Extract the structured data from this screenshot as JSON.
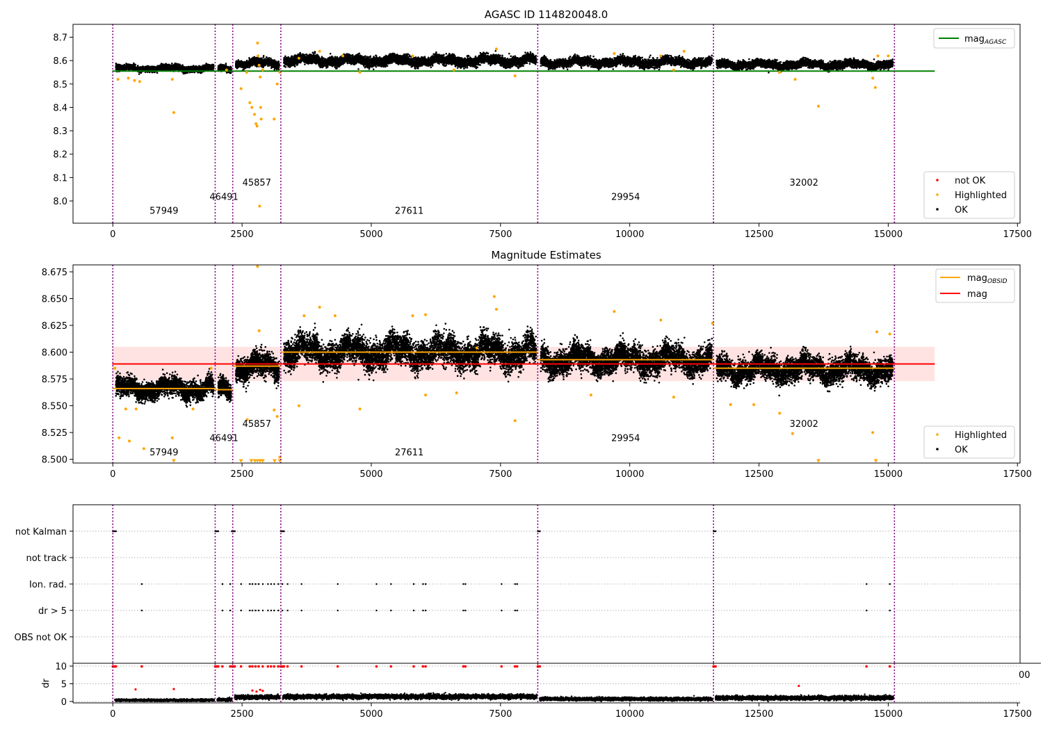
{
  "colors": {
    "ok": "#000000",
    "highlighted": "#ffa500",
    "not_ok": "#ff0000",
    "agasc_line": "#008000",
    "mag_line": "#ff0000",
    "obsid_line": "#ffa500",
    "band": "#ffc0c0",
    "obsid_vline": "#800080"
  },
  "chart_data": [
    {
      "type": "scatter",
      "title": "AGASC ID 114820048.0",
      "xlim": [
        -770,
        17550
      ],
      "ylim": [
        7.905,
        8.755
      ],
      "xticks": [
        0,
        2500,
        5000,
        7500,
        10000,
        12500,
        15000,
        17500
      ],
      "yticks": [
        8.0,
        8.1,
        8.2,
        8.3,
        8.4,
        8.5,
        8.6,
        8.7
      ],
      "ytick_labels": [
        "8.0",
        "8.1",
        "8.2",
        "8.3",
        "8.4",
        "8.5",
        "8.6",
        "8.7"
      ],
      "obsid_boundaries": [
        0,
        1980,
        2320,
        3250,
        8220,
        11620,
        15120
      ],
      "obsid_labels": [
        {
          "text": "57949",
          "x": 990,
          "y": 7.945
        },
        {
          "text": "46491",
          "x": 2150,
          "y": 8.005
        },
        {
          "text": "45857",
          "x": 2785,
          "y": 8.065
        },
        {
          "text": "27611",
          "x": 5735,
          "y": 7.945
        },
        {
          "text": "29954",
          "x": 9920,
          "y": 8.005
        },
        {
          "text": "32002",
          "x": 13370,
          "y": 8.065
        }
      ],
      "segments": [
        {
          "x0": 0,
          "x1": 1980,
          "base": 8.567,
          "spread": 0.015
        },
        {
          "x0": 1980,
          "x1": 2320,
          "base": 8.565,
          "spread": 0.015
        },
        {
          "x0": 2320,
          "x1": 3250,
          "base": 8.588,
          "spread": 0.02
        },
        {
          "x0": 3250,
          "x1": 8220,
          "base": 8.6,
          "spread": 0.024
        },
        {
          "x0": 8220,
          "x1": 11620,
          "base": 8.593,
          "spread": 0.022
        },
        {
          "x0": 11620,
          "x1": 15120,
          "base": 8.583,
          "spread": 0.02
        }
      ],
      "hlines": [
        {
          "name": "mag_AGASC",
          "y": 8.555,
          "x0": -10,
          "x1": 15900,
          "color": "#008000"
        }
      ],
      "highlighted": [
        [
          100,
          8.52
        ],
        [
          300,
          8.525
        ],
        [
          420,
          8.515
        ],
        [
          520,
          8.51
        ],
        [
          1150,
          8.52
        ],
        [
          1180,
          8.378
        ],
        [
          2200,
          8.56
        ],
        [
          2480,
          8.48
        ],
        [
          2590,
          8.55
        ],
        [
          2650,
          8.42
        ],
        [
          2690,
          8.4
        ],
        [
          2740,
          8.37
        ],
        [
          2770,
          8.33
        ],
        [
          2790,
          8.32
        ],
        [
          2800,
          8.675
        ],
        [
          2810,
          8.62
        ],
        [
          2830,
          8.58
        ],
        [
          2850,
          8.53
        ],
        [
          2860,
          8.4
        ],
        [
          2870,
          8.35
        ],
        [
          2900,
          8.56
        ],
        [
          3120,
          8.35
        ],
        [
          3180,
          8.5
        ],
        [
          3230,
          8.55
        ],
        [
          3600,
          8.61
        ],
        [
          4000,
          8.64
        ],
        [
          4450,
          8.62
        ],
        [
          4780,
          8.55
        ],
        [
          5800,
          8.62
        ],
        [
          7420,
          8.65
        ],
        [
          7780,
          8.535
        ],
        [
          6600,
          8.56
        ],
        [
          9700,
          8.63
        ],
        [
          10600,
          8.62
        ],
        [
          11050,
          8.64
        ],
        [
          10850,
          8.56
        ],
        [
          12900,
          8.55
        ],
        [
          13200,
          8.52
        ],
        [
          13650,
          8.405
        ],
        [
          14700,
          8.525
        ],
        [
          14750,
          8.485
        ],
        [
          14800,
          8.62
        ],
        [
          15000,
          8.62
        ],
        [
          2840,
          7.978
        ]
      ],
      "legend": [
        {
          "label": "mag",
          "sub": "AGASC",
          "kind": "line",
          "color": "#008000"
        }
      ],
      "legend2": [
        {
          "label": "not OK",
          "kind": "dot",
          "color": "#ff0000"
        },
        {
          "label": "Highlighted",
          "kind": "dot",
          "color": "#ffa500"
        },
        {
          "label": "OK",
          "kind": "dot",
          "color": "#000000"
        }
      ]
    },
    {
      "type": "scatter",
      "title": "Magnitude Estimates",
      "xlim": [
        -770,
        17550
      ],
      "ylim": [
        8.4965,
        8.6815
      ],
      "xticks": [
        0,
        2500,
        5000,
        7500,
        10000,
        12500,
        15000,
        17500
      ],
      "yticks": [
        8.5,
        8.525,
        8.55,
        8.575,
        8.6,
        8.625,
        8.65,
        8.675
      ],
      "ytick_labels": [
        "8.500",
        "8.525",
        "8.550",
        "8.575",
        "8.600",
        "8.625",
        "8.650",
        "8.675"
      ],
      "obsid_boundaries": [
        0,
        1980,
        2320,
        3250,
        8220,
        11620,
        15120
      ],
      "obsid_labels": [
        {
          "text": "57949",
          "x": 990,
          "y": 8.5037
        },
        {
          "text": "46491",
          "x": 2150,
          "y": 8.5169
        },
        {
          "text": "45857",
          "x": 2785,
          "y": 8.5301
        },
        {
          "text": "27611",
          "x": 5735,
          "y": 8.5037
        },
        {
          "text": "29954",
          "x": 9920,
          "y": 8.5169
        },
        {
          "text": "32002",
          "x": 13370,
          "y": 8.5301
        }
      ],
      "segments": [
        {
          "x0": 0,
          "x1": 1980,
          "base": 8.566,
          "spread": 0.011
        },
        {
          "x0": 1980,
          "x1": 2320,
          "base": 8.565,
          "spread": 0.011
        },
        {
          "x0": 2320,
          "x1": 3250,
          "base": 8.586,
          "spread": 0.014
        },
        {
          "x0": 3250,
          "x1": 8220,
          "base": 8.6,
          "spread": 0.017
        },
        {
          "x0": 8220,
          "x1": 11620,
          "base": 8.593,
          "spread": 0.015
        },
        {
          "x0": 11620,
          "x1": 15120,
          "base": 8.584,
          "spread": 0.014
        }
      ],
      "band": {
        "y0": 8.573,
        "y1": 8.605,
        "x0": -10,
        "x1": 15900
      },
      "hlines": [
        {
          "name": "mag",
          "y": 8.589,
          "x0": -10,
          "x1": 15900,
          "color": "#ff0000"
        }
      ],
      "obsid_means": [
        {
          "x0": 0,
          "x1": 1980,
          "y": 8.566
        },
        {
          "x0": 1980,
          "x1": 2320,
          "y": 8.565
        },
        {
          "x0": 2320,
          "x1": 3250,
          "y": 8.587
        },
        {
          "x0": 3250,
          "x1": 8220,
          "y": 8.6
        },
        {
          "x0": 8220,
          "x1": 11620,
          "y": 8.593
        },
        {
          "x0": 11620,
          "x1": 15120,
          "y": 8.585
        }
      ],
      "highlighted": [
        [
          40,
          8.585
        ],
        [
          120,
          8.52
        ],
        [
          250,
          8.547
        ],
        [
          450,
          8.547
        ],
        [
          600,
          8.51
        ],
        [
          320,
          8.517
        ],
        [
          1150,
          8.52
        ],
        [
          1550,
          8.547
        ],
        [
          1900,
          8.585
        ],
        [
          2600,
          8.537
        ],
        [
          2800,
          8.68
        ],
        [
          2830,
          8.62
        ],
        [
          3120,
          8.546
        ],
        [
          3180,
          8.54
        ],
        [
          3230,
          8.502
        ],
        [
          3600,
          8.55
        ],
        [
          3700,
          8.634
        ],
        [
          4000,
          8.642
        ],
        [
          4780,
          8.547
        ],
        [
          4300,
          8.634
        ],
        [
          5400,
          8.6
        ],
        [
          5800,
          8.634
        ],
        [
          6650,
          8.562
        ],
        [
          6050,
          8.635
        ],
        [
          7380,
          8.652
        ],
        [
          7420,
          8.64
        ],
        [
          7780,
          8.536
        ],
        [
          7040,
          8.604
        ],
        [
          9700,
          8.638
        ],
        [
          9250,
          8.56
        ],
        [
          10600,
          8.63
        ],
        [
          10850,
          8.558
        ],
        [
          11600,
          8.627
        ],
        [
          11950,
          8.551
        ],
        [
          12400,
          8.551
        ],
        [
          13150,
          8.524
        ],
        [
          12900,
          8.543
        ],
        [
          14700,
          8.525
        ],
        [
          14780,
          8.619
        ],
        [
          15030,
          8.617
        ],
        [
          6050,
          8.56
        ]
      ],
      "triangles": [
        [
          1180,
          8.4975
        ],
        [
          2480,
          8.4975
        ],
        [
          2680,
          8.4975
        ],
        [
          2750,
          8.4975
        ],
        [
          2800,
          8.4975
        ],
        [
          2850,
          8.4975
        ],
        [
          2900,
          8.4975
        ],
        [
          3130,
          8.4975
        ],
        [
          3230,
          8.4975
        ],
        [
          13650,
          8.4975
        ],
        [
          14760,
          8.4975
        ]
      ],
      "legend": [
        {
          "label": "mag",
          "sub": "OBSID",
          "kind": "line",
          "color": "#ffa500"
        },
        {
          "label": "mag",
          "sub": "",
          "kind": "line",
          "color": "#ff0000"
        }
      ],
      "legend2": [
        {
          "label": "Highlighted",
          "kind": "dot",
          "color": "#ffa500"
        },
        {
          "label": "OK",
          "kind": "dot",
          "color": "#000000"
        }
      ]
    },
    {
      "type": "scatter",
      "title": "",
      "xlim": [
        -770,
        17550
      ],
      "flag_labels": [
        "not Kalman",
        "not track",
        "Ion. rad.",
        "dr > 5",
        "OBS not OK"
      ],
      "obsid_boundaries": [
        0,
        1980,
        2320,
        3250,
        8220,
        11620,
        15120
      ],
      "flags": {
        "not Kalman": [
          0,
          20,
          40,
          60,
          1980,
          2000,
          2020,
          2040,
          2300,
          2320,
          2340,
          2360,
          3250,
          3270,
          3290,
          3310,
          8220,
          8240,
          8260,
          11620,
          11640,
          11660
        ],
        "not track": [],
        "Ion. rad.": [
          560,
          2120,
          2270,
          2480,
          2650,
          2700,
          2760,
          2820,
          2900,
          3000,
          3060,
          3120,
          3200,
          3280,
          3380,
          3650,
          4350,
          5100,
          5380,
          5820,
          6000,
          6050,
          6780,
          6820,
          7520,
          7780,
          7820,
          14580,
          15030
        ],
        "dr > 5": [
          560,
          2120,
          2270,
          2480,
          2650,
          2700,
          2760,
          2820,
          2900,
          3000,
          3060,
          3120,
          3200,
          3280,
          3380,
          3650,
          4350,
          5100,
          5380,
          5820,
          6000,
          6050,
          6780,
          6820,
          7520,
          7780,
          7820,
          14580,
          15030
        ],
        "OBS not OK": []
      },
      "dr": {
        "ylabel": "dr",
        "ylim": [
          -0.4,
          10.8
        ],
        "yticks": [
          0,
          5,
          10
        ],
        "ytick_labels": [
          "0",
          "5",
          "10"
        ],
        "clipped_x": [
          0,
          20,
          40,
          60,
          560,
          1980,
          2000,
          2020,
          2040,
          2120,
          2270,
          2300,
          2320,
          2340,
          2360,
          2480,
          2650,
          2700,
          2760,
          2820,
          2900,
          3000,
          3060,
          3120,
          3200,
          3250,
          3270,
          3290,
          3310,
          3380,
          3650,
          4350,
          5100,
          5380,
          5820,
          6000,
          6050,
          6780,
          6820,
          7520,
          7780,
          7820,
          8220,
          8240,
          8260,
          11620,
          11640,
          11660,
          14580,
          15030
        ],
        "red_points": [
          [
            440,
            3.4
          ],
          [
            1180,
            3.5
          ],
          [
            2700,
            3.1
          ],
          [
            2780,
            2.8
          ],
          [
            2850,
            3.3
          ],
          [
            2900,
            3.0
          ],
          [
            13270,
            4.4
          ]
        ],
        "segments": [
          {
            "x0": 0,
            "x1": 1980,
            "base": 0.35,
            "spread": 0.25
          },
          {
            "x0": 1980,
            "x1": 2320,
            "base": 0.5,
            "spread": 0.3
          },
          {
            "x0": 2320,
            "x1": 3250,
            "base": 1.2,
            "spread": 0.45
          },
          {
            "x0": 3250,
            "x1": 8220,
            "base": 1.35,
            "spread": 0.5
          },
          {
            "x0": 8220,
            "x1": 11620,
            "base": 0.7,
            "spread": 0.35
          },
          {
            "x0": 11620,
            "x1": 15120,
            "base": 1.0,
            "spread": 0.45
          }
        ]
      },
      "xticks": [
        0,
        2500,
        5000,
        7500,
        10000,
        12500,
        15000,
        17500
      ],
      "stray_tick": "00"
    }
  ]
}
